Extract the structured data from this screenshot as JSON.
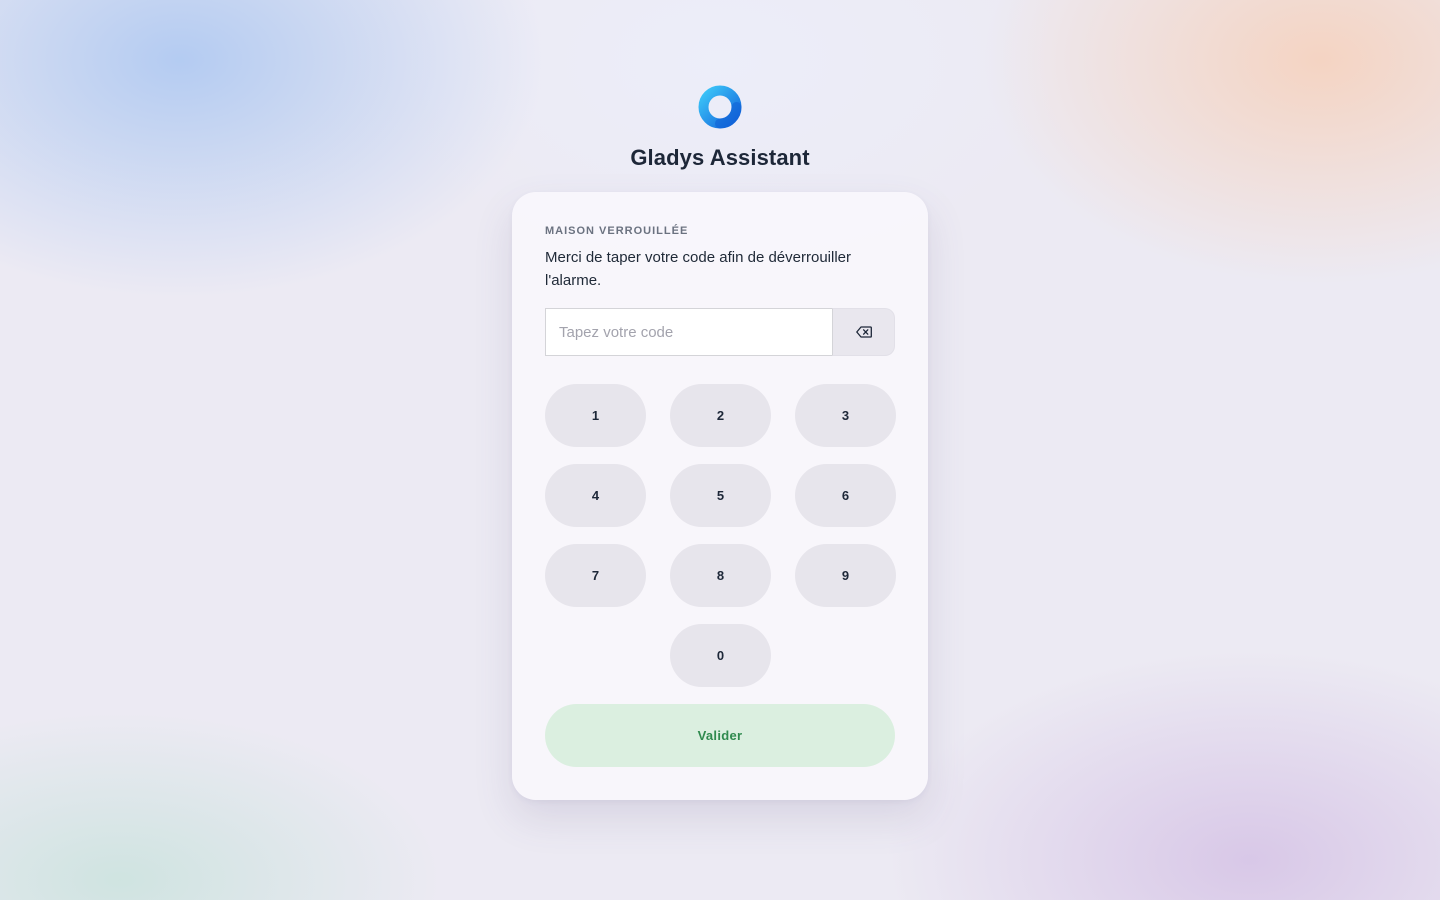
{
  "app": {
    "title": "Gladys Assistant",
    "logo_icon": "ring-logo-icon",
    "logo_colors": [
      "#2db4f5",
      "#1574e0"
    ]
  },
  "lock_card": {
    "status_label": "MAISON VERROUILLÉE",
    "message": "Merci de taper votre code afin de déverrouiller l'alarme.",
    "code_input": {
      "value": "",
      "placeholder": "Tapez votre code"
    },
    "backspace_icon": "backspace-icon",
    "keypad": {
      "keys": [
        "1",
        "2",
        "3",
        "4",
        "5",
        "6",
        "7",
        "8",
        "9",
        "0"
      ]
    },
    "submit_label": "Valider",
    "submit_color": "#2f8a4e"
  }
}
